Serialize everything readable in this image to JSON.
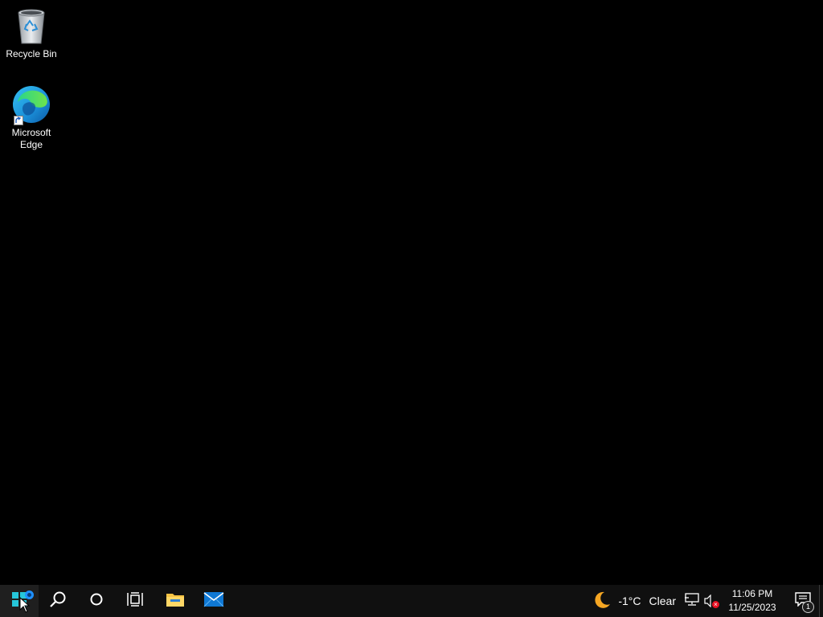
{
  "desktop": {
    "icons": [
      {
        "label": "Recycle Bin",
        "icon": "recycle-bin-icon"
      },
      {
        "label": "Microsoft Edge",
        "icon": "edge-icon"
      }
    ]
  },
  "taskbar": {
    "buttons": [
      {
        "name": "start-button",
        "icon": "windows-logo-icon"
      },
      {
        "name": "search-button",
        "icon": "search-icon"
      },
      {
        "name": "cortana-button",
        "icon": "cortana-circle-icon"
      },
      {
        "name": "task-view-button",
        "icon": "task-view-icon"
      },
      {
        "name": "file-explorer-button",
        "icon": "folder-icon"
      },
      {
        "name": "mail-button",
        "icon": "mail-icon"
      }
    ],
    "weather": {
      "icon": "moon-icon",
      "temperature": "-1°C",
      "condition": "Clear"
    },
    "tray": {
      "network_icon": "network-icon",
      "volume_icon": "volume-muted-icon"
    },
    "clock": {
      "time": "11:06 PM",
      "date": "11/25/2023"
    },
    "notifications": {
      "icon": "action-center-icon",
      "count": "1"
    }
  },
  "colors": {
    "desktop_bg": "#000000",
    "taskbar_bg": "#101010",
    "start_active_bg": "#1f1f1f",
    "text": "#ffffff",
    "mail_blue": "#0f78d4",
    "folder_yellow": "#f6c343",
    "moon_orange": "#f5a623",
    "mute_red": "#e81123"
  }
}
